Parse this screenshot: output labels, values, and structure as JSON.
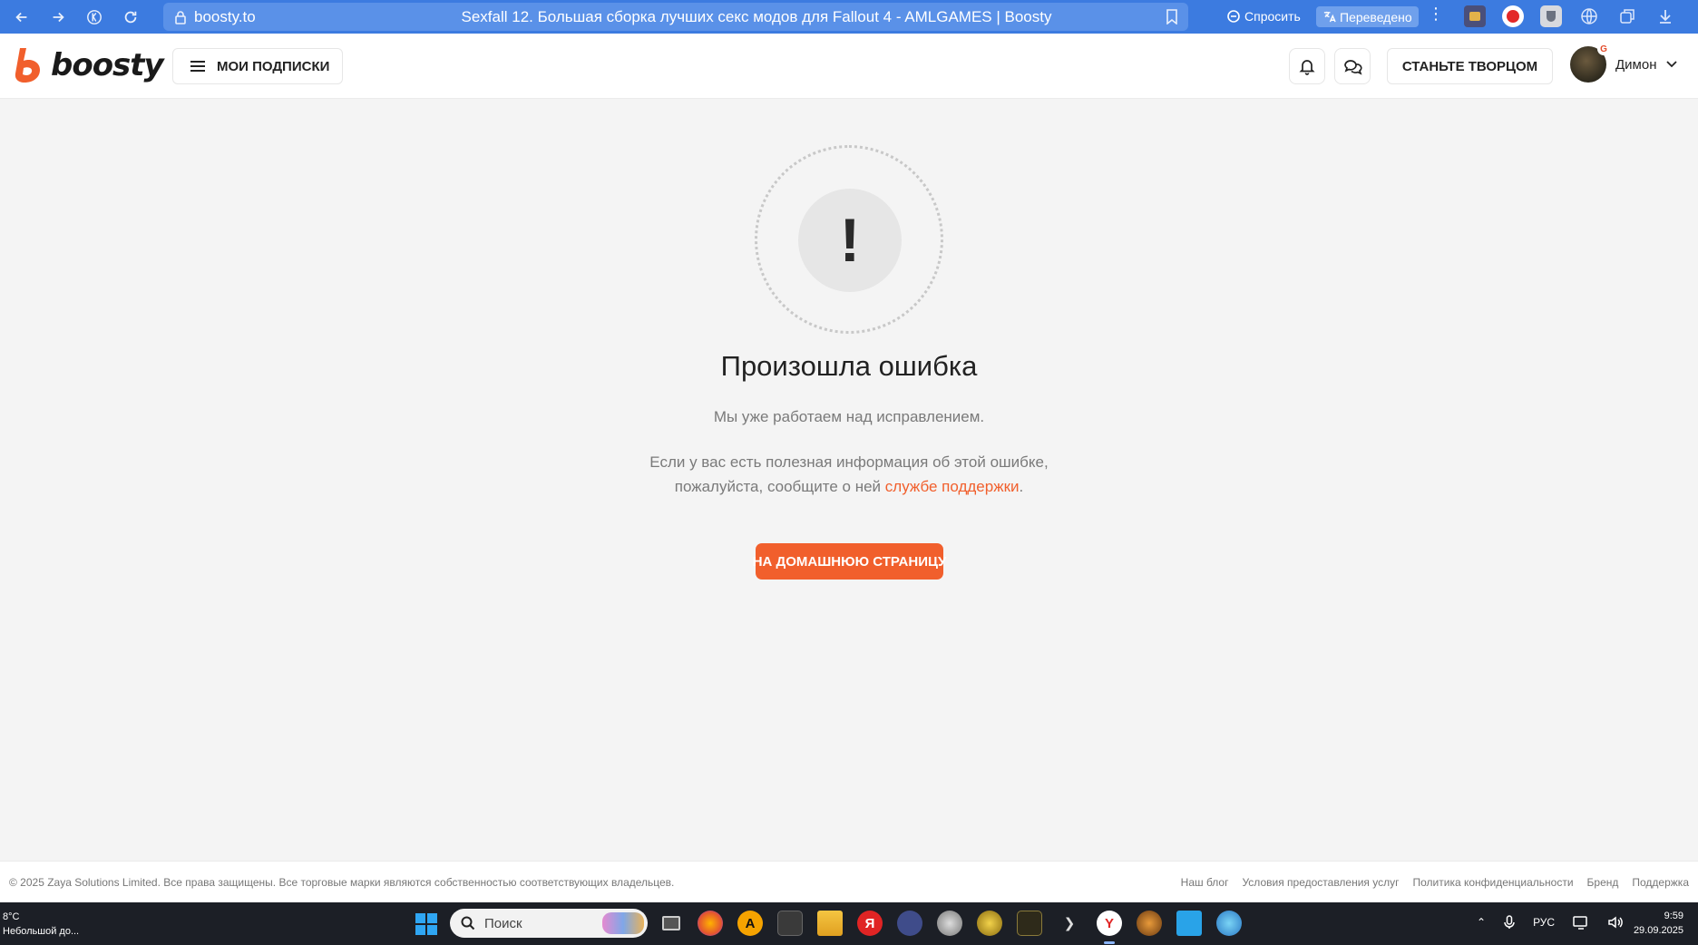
{
  "browser": {
    "domain": "boosty.to",
    "title": "Sexfall 12. Большая сборка лучших секс модов для Fallout 4 - AMLGAMES | Boosty",
    "ask_label": "Спросить",
    "translated_label": "Переведено"
  },
  "header": {
    "logo_text": "boosty",
    "subscriptions_label": "МОИ ПОДПИСКИ",
    "become_creator_label": "СТАНЬТЕ ТВОРЦОМ",
    "user_name": "Димон",
    "avatar_badge": "G"
  },
  "error": {
    "mark": "!",
    "title": "Произошла ошибка",
    "subtitle": "Мы уже работаем над исправлением.",
    "text_line1": "Если у вас есть полезная информация об этой ошибке,",
    "text_line2_prefix": "пожалуйста, сообщите о ней ",
    "support_link": "службе поддержки",
    "text_line2_suffix": ".",
    "home_button": "НА ДОМАШНЮЮ СТРАНИЦУ"
  },
  "footer": {
    "copyright": "© 2025 Zaya Solutions Limited. Все права защищены. Все торговые марки являются собственностью соответствующих владельцев.",
    "links": [
      "Наш блог",
      "Условия предоставления услуг",
      "Политика конфиденциальности",
      "Бренд",
      "Поддержка"
    ]
  },
  "taskbar": {
    "weather_temp": "8°C",
    "weather_desc": "Небольшой до...",
    "search_placeholder": "Поиск",
    "language": "РУС",
    "time": "9:59",
    "date": "29.09.2025"
  },
  "colors": {
    "accent": "#f15f2c",
    "browser_bar": "#3c7be0",
    "page_bg": "#f4f4f4"
  }
}
